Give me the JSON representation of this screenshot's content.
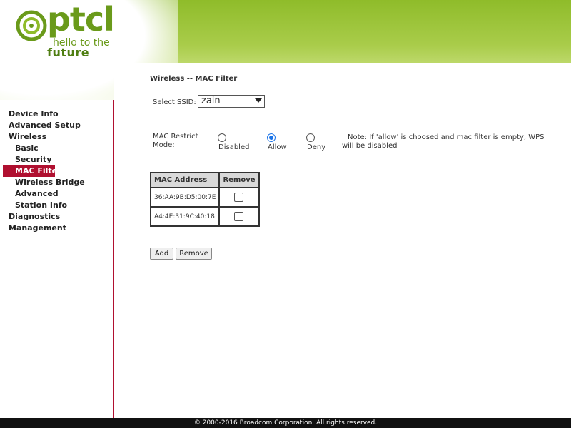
{
  "header": {
    "logo_text": "ptcl",
    "tagline_1": "hello to the",
    "tagline_2": "future"
  },
  "sidebar": {
    "items": [
      {
        "label": "Device Info",
        "level": 0,
        "active": false
      },
      {
        "label": "Advanced Setup",
        "level": 0,
        "active": false
      },
      {
        "label": "Wireless",
        "level": 0,
        "active": false
      },
      {
        "label": "Basic",
        "level": 1,
        "active": false
      },
      {
        "label": "Security",
        "level": 1,
        "active": false
      },
      {
        "label": "MAC Filter",
        "level": 1,
        "active": true
      },
      {
        "label": "Wireless Bridge",
        "level": 1,
        "active": false
      },
      {
        "label": "Advanced",
        "level": 1,
        "active": false
      },
      {
        "label": "Station Info",
        "level": 1,
        "active": false
      },
      {
        "label": "Diagnostics",
        "level": 0,
        "active": false
      },
      {
        "label": "Management",
        "level": 0,
        "active": false
      }
    ]
  },
  "main": {
    "title": "Wireless -- MAC Filter",
    "ssid": {
      "label": "Select SSID:",
      "value": "zain"
    },
    "mac_restrict": {
      "label": "MAC Restrict Mode:",
      "options": [
        {
          "label": "Disabled",
          "checked": false
        },
        {
          "label": "Allow",
          "checked": true
        },
        {
          "label": "Deny",
          "checked": false
        }
      ],
      "note": "Note: If 'allow' is choosed and mac filter is empty, WPS will be disabled"
    },
    "table": {
      "headers": [
        "MAC Address",
        "Remove"
      ],
      "rows": [
        {
          "mac": "36:AA:9B:D5:00:7E",
          "remove_checked": false
        },
        {
          "mac": "A4:4E:31:9C:40:18",
          "remove_checked": false
        }
      ]
    },
    "buttons": {
      "add": "Add",
      "remove": "Remove"
    }
  },
  "footer": {
    "text": "© 2000-2016 Broadcom Corporation. All rights reserved."
  },
  "colors": {
    "accent": "#b01030",
    "brand_green": "#6a9a1a",
    "radio_selected": "#1a73e8"
  }
}
